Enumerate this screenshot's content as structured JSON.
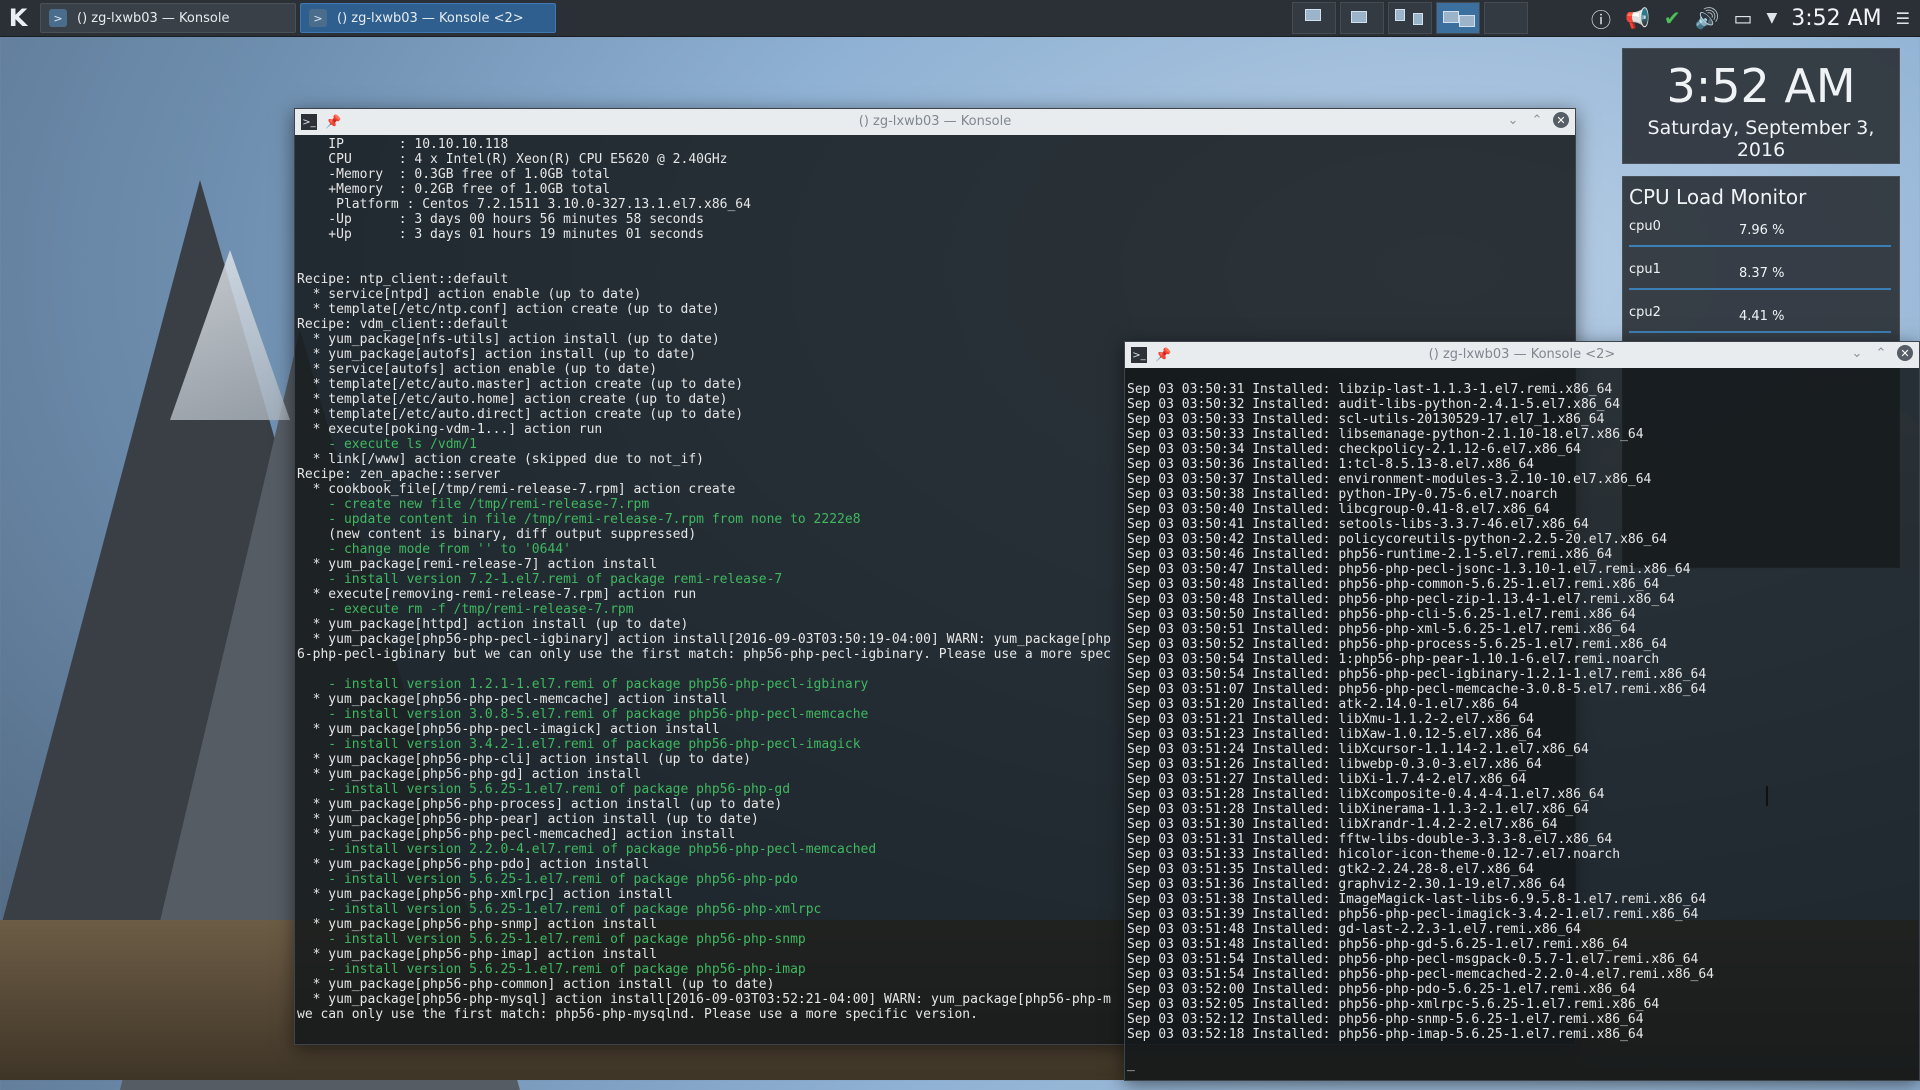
{
  "taskbar": {
    "tasks": [
      {
        "label": "() zg-lxwb03 — Konsole"
      },
      {
        "label": "() zg-lxwb03 — Konsole <2>"
      }
    ],
    "clock": "3:52 AM"
  },
  "clock_widget": {
    "time": "3:52 AM",
    "date": "Saturday, September 3, 2016"
  },
  "cpu_monitor": {
    "title": "CPU Load Monitor",
    "rows": [
      {
        "name": "cpu0",
        "value": "7.96 %"
      },
      {
        "name": "cpu1",
        "value": "8.37 %"
      },
      {
        "name": "cpu2",
        "value": "4.41 %"
      }
    ]
  },
  "window1": {
    "title": "() zg-lxwb03 — Konsole",
    "lines": [
      {
        "t": "    IP       : 10.10.10.118"
      },
      {
        "t": "    CPU      : 4 x Intel(R) Xeon(R) CPU E5620 @ 2.40GHz"
      },
      {
        "t": "    -Memory  : 0.3GB free of 1.0GB total"
      },
      {
        "t": "    +Memory  : 0.2GB free of 1.0GB total"
      },
      {
        "t": "     Platform : Centos 7.2.1511 3.10.0-327.13.1.el7.x86_64"
      },
      {
        "t": "    -Up      : 3 days 00 hours 56 minutes 58 seconds"
      },
      {
        "t": "    +Up      : 3 days 01 hours 19 minutes 01 seconds"
      },
      {
        "t": ""
      },
      {
        "t": ""
      },
      {
        "t": "Recipe: ntp_client::default"
      },
      {
        "t": "  * service[ntpd] action enable (up to date)"
      },
      {
        "t": "  * template[/etc/ntp.conf] action create (up to date)"
      },
      {
        "t": "Recipe: vdm_client::default"
      },
      {
        "t": "  * yum_package[nfs-utils] action install (up to date)"
      },
      {
        "t": "  * yum_package[autofs] action install (up to date)"
      },
      {
        "t": "  * service[autofs] action enable (up to date)"
      },
      {
        "t": "  * template[/etc/auto.master] action create (up to date)"
      },
      {
        "t": "  * template[/etc/auto.home] action create (up to date)"
      },
      {
        "t": "  * template[/etc/auto.direct] action create (up to date)"
      },
      {
        "t": "  * execute[poking-vdm-1...] action run"
      },
      {
        "t": "    - execute ls /vdm/1",
        "g": true
      },
      {
        "t": "  * link[/www] action create (skipped due to not_if)"
      },
      {
        "t": "Recipe: zen_apache::server"
      },
      {
        "t": "  * cookbook_file[/tmp/remi-release-7.rpm] action create"
      },
      {
        "t": "    - create new file /tmp/remi-release-7.rpm",
        "g": true
      },
      {
        "t": "    - update content in file /tmp/remi-release-7.rpm from none to 2222e8",
        "g": true
      },
      {
        "t": "    (new content is binary, diff output suppressed)"
      },
      {
        "t": "    - change mode from '' to '0644'",
        "g": true
      },
      {
        "t": "  * yum_package[remi-release-7] action install"
      },
      {
        "t": "    - install version 7.2-1.el7.remi of package remi-release-7",
        "g": true
      },
      {
        "t": "  * execute[removing-remi-release-7.rpm] action run"
      },
      {
        "t": "    - execute rm -f /tmp/remi-release-7.rpm",
        "g": true
      },
      {
        "t": "  * yum_package[httpd] action install (up to date)"
      },
      {
        "t": "  * yum_package[php56-php-pecl-igbinary] action install[2016-09-03T03:50:19-04:00] WARN: yum_package[php"
      },
      {
        "t": "6-php-pecl-igbinary but we can only use the first match: php56-php-pecl-igbinary. Please use a more spec"
      },
      {
        "t": ""
      },
      {
        "t": "    - install version 1.2.1-1.el7.remi of package php56-php-pecl-igbinary",
        "g": true
      },
      {
        "t": "  * yum_package[php56-php-pecl-memcache] action install"
      },
      {
        "t": "    - install version 3.0.8-5.el7.remi of package php56-php-pecl-memcache",
        "g": true
      },
      {
        "t": "  * yum_package[php56-php-pecl-imagick] action install"
      },
      {
        "t": "    - install version 3.4.2-1.el7.remi of package php56-php-pecl-imagick",
        "g": true
      },
      {
        "t": "  * yum_package[php56-php-cli] action install (up to date)"
      },
      {
        "t": "  * yum_package[php56-php-gd] action install"
      },
      {
        "t": "    - install version 5.6.25-1.el7.remi of package php56-php-gd",
        "g": true
      },
      {
        "t": "  * yum_package[php56-php-process] action install (up to date)"
      },
      {
        "t": "  * yum_package[php56-php-pear] action install (up to date)"
      },
      {
        "t": "  * yum_package[php56-php-pecl-memcached] action install"
      },
      {
        "t": "    - install version 2.2.0-4.el7.remi of package php56-php-pecl-memcached",
        "g": true
      },
      {
        "t": "  * yum_package[php56-php-pdo] action install"
      },
      {
        "t": "    - install version 5.6.25-1.el7.remi of package php56-php-pdo",
        "g": true
      },
      {
        "t": "  * yum_package[php56-php-xmlrpc] action install"
      },
      {
        "t": "    - install version 5.6.25-1.el7.remi of package php56-php-xmlrpc",
        "g": true
      },
      {
        "t": "  * yum_package[php56-php-snmp] action install"
      },
      {
        "t": "    - install version 5.6.25-1.el7.remi of package php56-php-snmp",
        "g": true
      },
      {
        "t": "  * yum_package[php56-php-imap] action install"
      },
      {
        "t": "    - install version 5.6.25-1.el7.remi of package php56-php-imap",
        "g": true
      },
      {
        "t": "  * yum_package[php56-php-common] action install (up to date)"
      },
      {
        "t": "  * yum_package[php56-php-mysql] action install[2016-09-03T03:52:21-04:00] WARN: yum_package[php56-php-m"
      },
      {
        "t": "we can only use the first match: php56-php-mysqlnd. Please use a more specific version."
      },
      {
        "t": ""
      },
      {
        "t": "_"
      }
    ]
  },
  "window2": {
    "title": "() zg-lxwb03 — Konsole <2>",
    "lines": [
      "Sep 03 03:50:31 Installed: libzip-last-1.1.3-1.el7.remi.x86_64",
      "Sep 03 03:50:32 Installed: audit-libs-python-2.4.1-5.el7.x86_64",
      "Sep 03 03:50:33 Installed: scl-utils-20130529-17.el7_1.x86_64",
      "Sep 03 03:50:33 Installed: libsemanage-python-2.1.10-18.el7.x86_64",
      "Sep 03 03:50:34 Installed: checkpolicy-2.1.12-6.el7.x86_64",
      "Sep 03 03:50:36 Installed: 1:tcl-8.5.13-8.el7.x86_64",
      "Sep 03 03:50:37 Installed: environment-modules-3.2.10-10.el7.x86_64",
      "Sep 03 03:50:38 Installed: python-IPy-0.75-6.el7.noarch",
      "Sep 03 03:50:40 Installed: libcgroup-0.41-8.el7.x86_64",
      "Sep 03 03:50:41 Installed: setools-libs-3.3.7-46.el7.x86_64",
      "Sep 03 03:50:42 Installed: policycoreutils-python-2.2.5-20.el7.x86_64",
      "Sep 03 03:50:46 Installed: php56-runtime-2.1-5.el7.remi.x86_64",
      "Sep 03 03:50:47 Installed: php56-php-pecl-jsonc-1.3.10-1.el7.remi.x86_64",
      "Sep 03 03:50:48 Installed: php56-php-common-5.6.25-1.el7.remi.x86_64",
      "Sep 03 03:50:48 Installed: php56-php-pecl-zip-1.13.4-1.el7.remi.x86_64",
      "Sep 03 03:50:50 Installed: php56-php-cli-5.6.25-1.el7.remi.x86_64",
      "Sep 03 03:50:51 Installed: php56-php-xml-5.6.25-1.el7.remi.x86_64",
      "Sep 03 03:50:52 Installed: php56-php-process-5.6.25-1.el7.remi.x86_64",
      "Sep 03 03:50:54 Installed: 1:php56-php-pear-1.10.1-6.el7.remi.noarch",
      "Sep 03 03:50:54 Installed: php56-php-pecl-igbinary-1.2.1-1.el7.remi.x86_64",
      "Sep 03 03:51:07 Installed: php56-php-pecl-memcache-3.0.8-5.el7.remi.x86_64",
      "Sep 03 03:51:20 Installed: atk-2.14.0-1.el7.x86_64",
      "Sep 03 03:51:21 Installed: libXmu-1.1.2-2.el7.x86_64",
      "Sep 03 03:51:23 Installed: libXaw-1.0.12-5.el7.x86_64",
      "Sep 03 03:51:24 Installed: libXcursor-1.1.14-2.1.el7.x86_64",
      "Sep 03 03:51:26 Installed: libwebp-0.3.0-3.el7.x86_64",
      "Sep 03 03:51:27 Installed: libXi-1.7.4-2.el7.x86_64",
      "Sep 03 03:51:28 Installed: libXcomposite-0.4.4-4.1.el7.x86_64",
      "Sep 03 03:51:28 Installed: libXinerama-1.1.3-2.1.el7.x86_64",
      "Sep 03 03:51:30 Installed: libXrandr-1.4.2-2.el7.x86_64",
      "Sep 03 03:51:31 Installed: fftw-libs-double-3.3.3-8.el7.x86_64",
      "Sep 03 03:51:33 Installed: hicolor-icon-theme-0.12-7.el7.noarch",
      "Sep 03 03:51:35 Installed: gtk2-2.24.28-8.el7.x86_64",
      "Sep 03 03:51:36 Installed: graphviz-2.30.1-19.el7.x86_64",
      "Sep 03 03:51:38 Installed: ImageMagick-last-libs-6.9.5.8-1.el7.remi.x86_64",
      "Sep 03 03:51:39 Installed: php56-php-pecl-imagick-3.4.2-1.el7.remi.x86_64",
      "Sep 03 03:51:48 Installed: gd-last-2.2.3-1.el7.remi.x86_64",
      "Sep 03 03:51:48 Installed: php56-php-gd-5.6.25-1.el7.remi.x86_64",
      "Sep 03 03:51:54 Installed: php56-php-pecl-msgpack-0.5.7-1.el7.remi.x86_64",
      "Sep 03 03:51:54 Installed: php56-php-pecl-memcached-2.2.0-4.el7.remi.x86_64",
      "Sep 03 03:52:00 Installed: php56-php-pdo-5.6.25-1.el7.remi.x86_64",
      "Sep 03 03:52:05 Installed: php56-php-xmlrpc-5.6.25-1.el7.remi.x86_64",
      "Sep 03 03:52:12 Installed: php56-php-snmp-5.6.25-1.el7.remi.x86_64",
      "Sep 03 03:52:18 Installed: php56-php-imap-5.6.25-1.el7.remi.x86_64",
      "",
      "_"
    ]
  }
}
